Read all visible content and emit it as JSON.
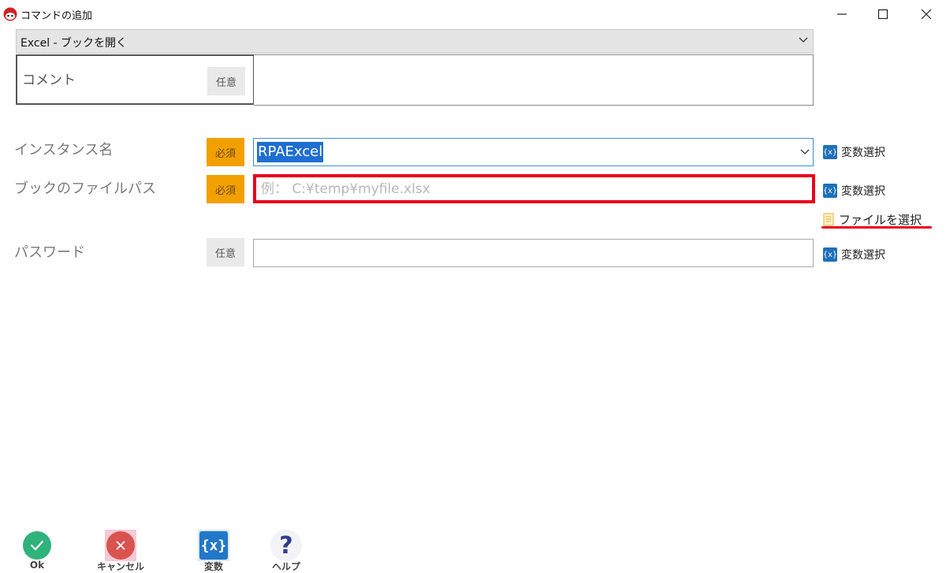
{
  "window": {
    "title": "コマンドの追加",
    "controls": {
      "minimize": "minimize-icon",
      "maximize": "maximize-icon",
      "close": "close-icon"
    }
  },
  "command": {
    "selected": "Excel - ブックを開く"
  },
  "comment": {
    "label": "コメント",
    "badge": "任意",
    "value": ""
  },
  "fields": {
    "instance": {
      "label": "インスタンス名",
      "badge": "必須",
      "value": "RPAExcel",
      "var_link": "変数選択"
    },
    "filepath": {
      "label": "ブックのファイルパス",
      "badge": "必須",
      "value": "",
      "placeholder": "例： C:¥temp¥myfile.xlsx",
      "var_link": "変数選択",
      "file_link": "ファイルを選択"
    },
    "password": {
      "label": "パスワード",
      "badge": "任意",
      "value": "",
      "var_link": "変数選択"
    }
  },
  "toolbar": {
    "ok": "Ok",
    "cancel": "キャンセル",
    "variables": "変数",
    "help": "ヘルプ"
  },
  "colors": {
    "required_badge": "#f2a000",
    "optional_badge": "#e9e9e9",
    "highlight_red": "#e8001c",
    "selection_blue": "#1f6fd0",
    "var_icon_blue": "#1e6fb9",
    "ok_green": "#2fb27b",
    "cancel_red": "#d9534f"
  }
}
